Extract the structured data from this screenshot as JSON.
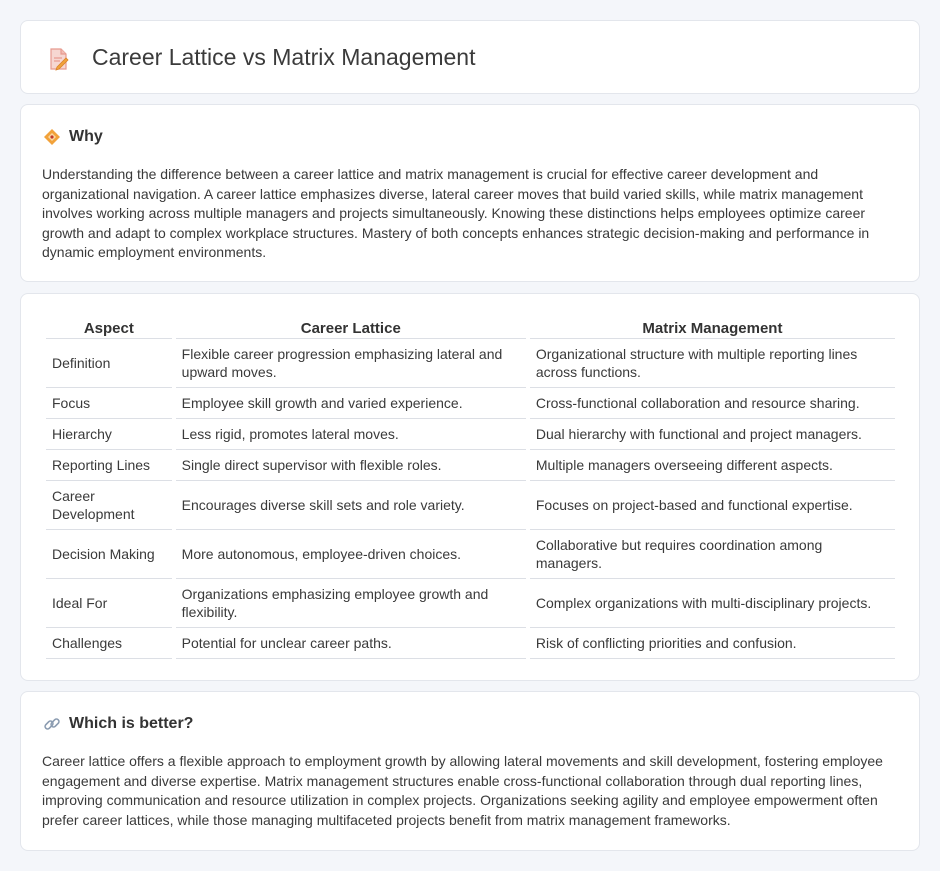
{
  "header": {
    "title": "Career Lattice vs Matrix Management",
    "icon": "document-pencil-icon"
  },
  "why": {
    "heading": "Why",
    "icon": "diamond-icon",
    "body": "Understanding the difference between a career lattice and matrix management is crucial for effective career development and organizational navigation. A career lattice emphasizes diverse, lateral career moves that build varied skills, while matrix management involves working across multiple managers and projects simultaneously. Knowing these distinctions helps employees optimize career growth and adapt to complex workplace structures. Mastery of both concepts enhances strategic decision-making and performance in dynamic employment environments."
  },
  "comparison": {
    "columns": [
      "Aspect",
      "Career Lattice",
      "Matrix Management"
    ],
    "rows": [
      [
        "Definition",
        "Flexible career progression emphasizing lateral and upward moves.",
        "Organizational structure with multiple reporting lines across functions."
      ],
      [
        "Focus",
        "Employee skill growth and varied experience.",
        "Cross-functional collaboration and resource sharing."
      ],
      [
        "Hierarchy",
        "Less rigid, promotes lateral moves.",
        "Dual hierarchy with functional and project managers."
      ],
      [
        "Reporting Lines",
        "Single direct supervisor with flexible roles.",
        "Multiple managers overseeing different aspects."
      ],
      [
        "Career Development",
        "Encourages diverse skill sets and role variety.",
        "Focuses on project-based and functional expertise."
      ],
      [
        "Decision Making",
        "More autonomous, employee-driven choices.",
        "Collaborative but requires coordination among managers."
      ],
      [
        "Ideal For",
        "Organizations emphasizing employee growth and flexibility.",
        "Complex organizations with multi-disciplinary projects."
      ],
      [
        "Challenges",
        "Potential for unclear career paths.",
        "Risk of conflicting priorities and confusion."
      ]
    ]
  },
  "better": {
    "heading": "Which is better?",
    "icon": "link-icon",
    "body": "Career lattice offers a flexible approach to employment growth by allowing lateral movements and skill development, fostering employee engagement and diverse expertise. Matrix management structures enable cross-functional collaboration through dual reporting lines, improving communication and resource utilization in complex projects. Organizations seeking agility and employee empowerment often prefer career lattices, while those managing multifaceted projects benefit from matrix management frameworks."
  },
  "colors": {
    "background": "#f4f6fa",
    "card": "#ffffff",
    "border": "#e3e6ec",
    "accent_orange": "#f2a23a",
    "accent_pink": "#e88a8a"
  }
}
